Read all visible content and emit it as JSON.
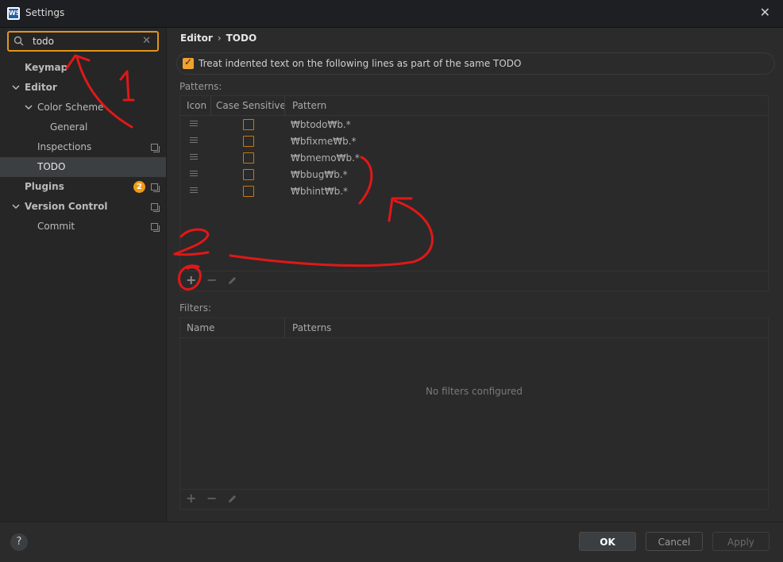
{
  "window": {
    "title": "Settings",
    "app_icon_text": "WS",
    "close_glyph": "✕"
  },
  "search": {
    "value": "todo",
    "clear_glyph": "✕"
  },
  "sidebar": {
    "items": [
      {
        "label": "Keymap"
      },
      {
        "label": "Editor"
      },
      {
        "label": "Color Scheme"
      },
      {
        "label": "General"
      },
      {
        "label": "Inspections"
      },
      {
        "label": "TODO"
      },
      {
        "label": "Plugins",
        "badge": "2"
      },
      {
        "label": "Version Control"
      },
      {
        "label": "Commit"
      }
    ]
  },
  "breadcrumb": {
    "parent": "Editor",
    "sep": "›",
    "current": "TODO"
  },
  "option": {
    "label": "Treat indented text on the following lines as part of the same TODO",
    "checked": true
  },
  "patterns": {
    "section_label": "Patterns:",
    "columns": [
      "Icon",
      "Case Sensitive",
      "Pattern"
    ],
    "rows": [
      "₩btodo₩b.*",
      "₩bfixme₩b.*",
      "₩bmemo₩b.*",
      "₩bbug₩b.*",
      "₩bhint₩b.*"
    ]
  },
  "filters": {
    "section_label": "Filters:",
    "columns": [
      "Name",
      "Patterns"
    ],
    "empty_text": "No filters configured"
  },
  "toolbar": {
    "add": "+",
    "remove": "−",
    "edit_icon": "pencil-icon"
  },
  "footer": {
    "help": "?",
    "ok": "OK",
    "cancel": "Cancel",
    "apply": "Apply"
  },
  "annotations": {
    "one": "1",
    "two": "2"
  },
  "colors": {
    "accent": "#e3941b",
    "annotation": "#e01818",
    "badge": "#f19b12"
  }
}
